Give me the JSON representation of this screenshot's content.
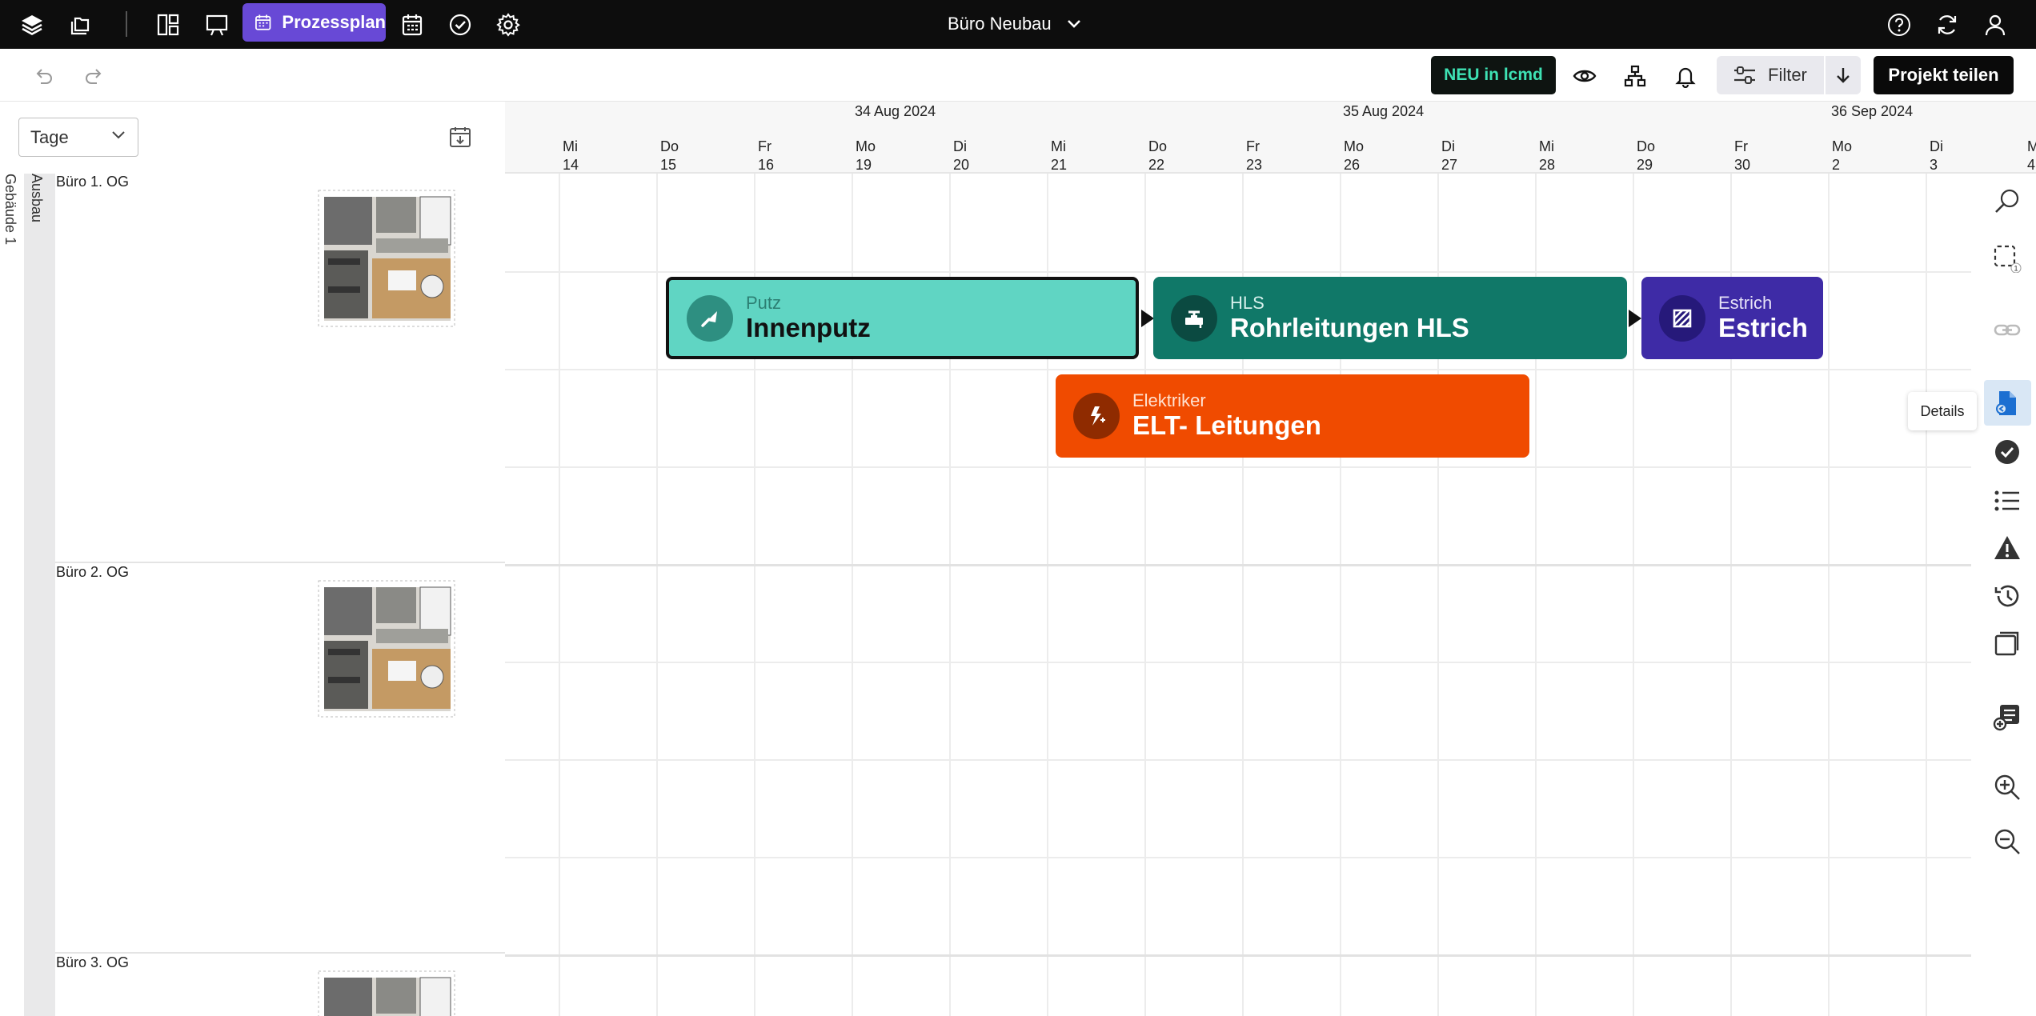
{
  "topbar": {
    "active_tab_label": "Prozessplan",
    "project_name": "Büro Neubau",
    "icons": [
      "layers-icon",
      "folder-icon",
      "dashboard-icon",
      "presentation-icon",
      "calendar-icon",
      "calendar-grid-icon",
      "check-circle-icon",
      "gear-icon",
      "help-icon",
      "sync-icon",
      "user-icon"
    ]
  },
  "toolbar": {
    "neu_badge": "NEU in lcmd",
    "filter_label": "Filter",
    "share_label": "Projekt teilen"
  },
  "left_panel": {
    "scale_value": "Tage",
    "building_label": "Gebäude 1",
    "section_label": "Ausbau",
    "floors": [
      {
        "label": "Büro 1. OG"
      },
      {
        "label": "Büro 2. OG"
      },
      {
        "label": "Büro 3. OG"
      }
    ]
  },
  "timeline": {
    "weeks": [
      {
        "label": "34 Aug 2024"
      },
      {
        "label": "35 Aug 2024"
      },
      {
        "label": "36 Sep 2024"
      }
    ],
    "days": [
      {
        "dow": "Mi",
        "num": "14"
      },
      {
        "dow": "Do",
        "num": "15"
      },
      {
        "dow": "Fr",
        "num": "16"
      },
      {
        "dow": "Mo",
        "num": "19"
      },
      {
        "dow": "Di",
        "num": "20"
      },
      {
        "dow": "Mi",
        "num": "21"
      },
      {
        "dow": "Do",
        "num": "22"
      },
      {
        "dow": "Fr",
        "num": "23"
      },
      {
        "dow": "Mo",
        "num": "26"
      },
      {
        "dow": "Di",
        "num": "27"
      },
      {
        "dow": "Mi",
        "num": "28"
      },
      {
        "dow": "Do",
        "num": "29"
      },
      {
        "dow": "Fr",
        "num": "30"
      },
      {
        "dow": "Mo",
        "num": "2"
      },
      {
        "dow": "Di",
        "num": "3"
      },
      {
        "dow": "M",
        "num": "4"
      }
    ]
  },
  "tasks": [
    {
      "trade": "Putz",
      "name": "Innenputz",
      "color": "#60d5c3",
      "icon": "trowel-icon"
    },
    {
      "trade": "HLS",
      "name": "Rohrleitungen  HLS",
      "color": "#107868",
      "icon": "valve-icon"
    },
    {
      "trade": "Estrich",
      "name": "Estrich",
      "color": "#3e2ba6",
      "icon": "hatch-icon"
    },
    {
      "trade": "Elektriker",
      "name": "ELT- Leitungen",
      "color": "#f04b00",
      "icon": "electric-icon"
    }
  ],
  "right_rail": {
    "tooltip": "Details",
    "selection_count": "1"
  }
}
